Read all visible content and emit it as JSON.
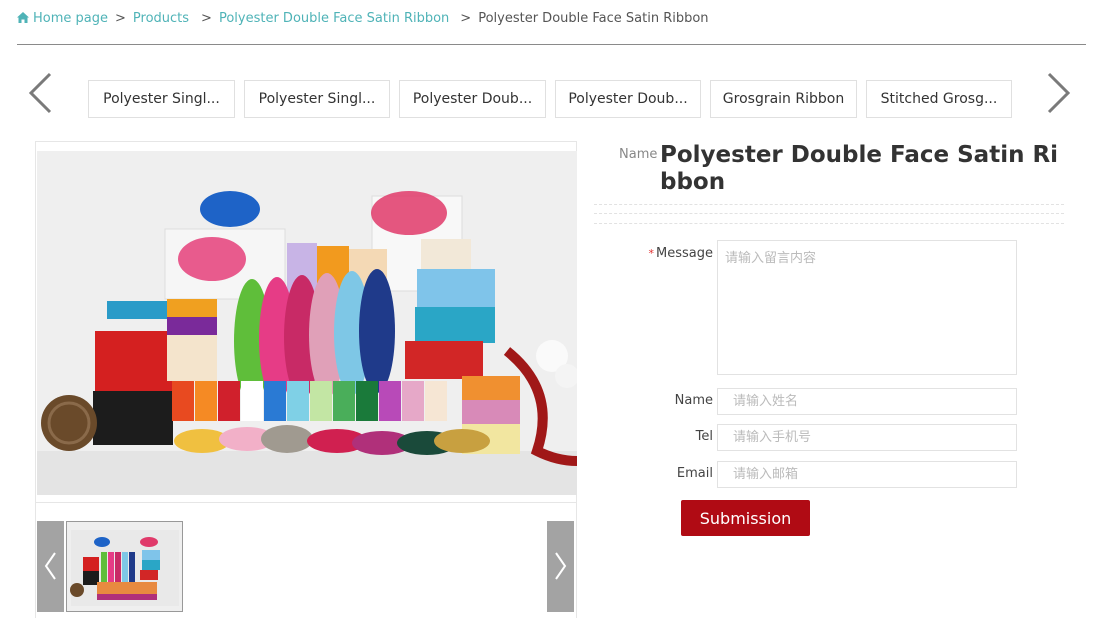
{
  "breadcrumb": {
    "items": [
      "Home page",
      "Products",
      "Polyester Double Face Satin Ribbon"
    ],
    "current": "Polyester Double Face Satin Ribbon",
    "separator": ">"
  },
  "categories": {
    "tabs": [
      "Polyester Singl...",
      "Polyester Singl...",
      "Polyester Doub...",
      "Polyester Doub...",
      "Grosgrain Ribbon",
      "Stitched Grosg..."
    ]
  },
  "product": {
    "name_label": "Name",
    "title": "Polyester Double Face Satin Ribbon"
  },
  "form": {
    "message_label": "Message",
    "message_placeholder": "请输入留言内容",
    "name_label": "Name",
    "name_placeholder": "请输入姓名",
    "tel_label": "Tel",
    "tel_placeholder": "请输入手机号",
    "email_label": "Email",
    "email_placeholder": "请输入邮箱",
    "submit_label": "Submission",
    "required_mark": "*"
  },
  "colors": {
    "link": "#4fb3b7",
    "button": "#b00b14"
  }
}
